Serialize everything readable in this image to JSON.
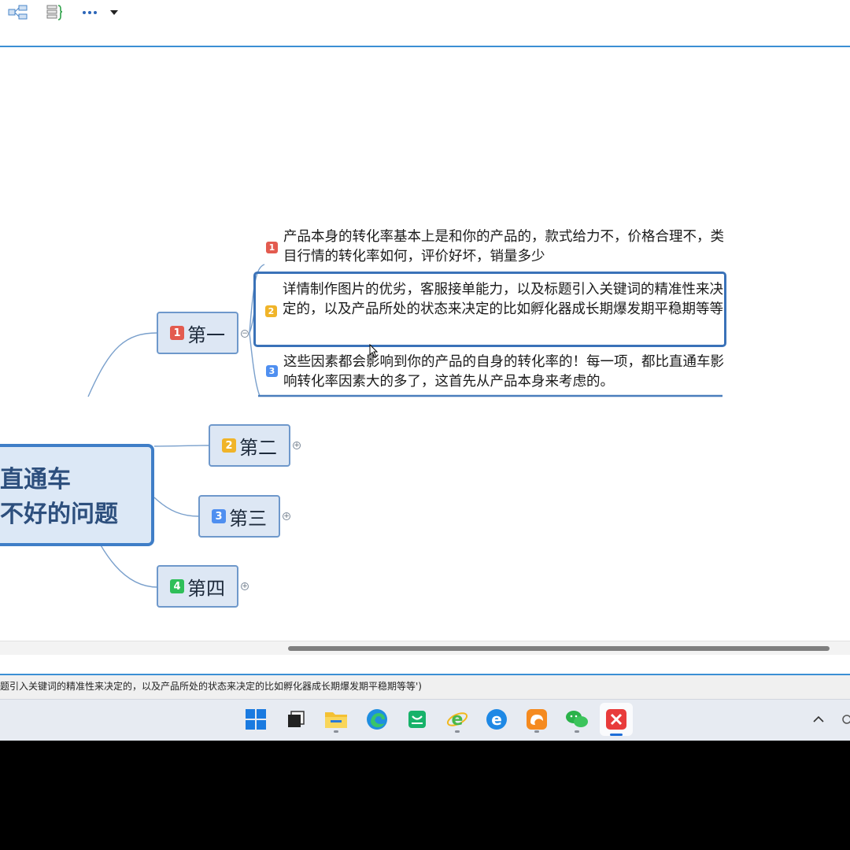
{
  "toolbar": {
    "items": [
      {
        "name": "mindmap-layout-icon"
      },
      {
        "name": "outline-view-icon"
      },
      {
        "name": "more-options-icon"
      },
      {
        "name": "dropdown-arrow-icon"
      }
    ]
  },
  "mindmap": {
    "root": {
      "line1": "直通车",
      "line2": "不好的问题"
    },
    "branches": [
      {
        "badge": "1",
        "label": "第一"
      },
      {
        "badge": "2",
        "label": "第二"
      },
      {
        "badge": "3",
        "label": "第三"
      },
      {
        "badge": "4",
        "label": "第四"
      }
    ],
    "leaves": [
      {
        "badge": "1",
        "text": "产品本身的转化率基本上是和你的产品的，款式给力不，价格合理不，类目行情的转化率如何，评价好坏，销量多少"
      },
      {
        "badge": "2",
        "text": "详情制作图片的优劣，客服接单能力，以及标题引入关键词的精准性来决定的，以及产品所处的状态来决定的比如孵化器成长期爆发期平稳期等等"
      },
      {
        "badge": "3",
        "text": "这些因素都会影响到你的产品的自身的转化率的！每一项，都比直通车影响转化率因素大的多了，这首先从产品本身来考虑的。"
      }
    ]
  },
  "statusbar": {
    "text": "题引入关键词的精准性来决定的，以及产品所处的状态来决定的比如孵化器成长期爆发期平稳期等等')"
  },
  "taskbar": {
    "apps": [
      {
        "name": "start-icon"
      },
      {
        "name": "task-view-icon"
      },
      {
        "name": "file-explorer-icon"
      },
      {
        "name": "edge-browser-icon"
      },
      {
        "name": "store-icon"
      },
      {
        "name": "ie-browser-icon"
      },
      {
        "name": "edge-legacy-icon"
      },
      {
        "name": "uc-browser-icon"
      },
      {
        "name": "wechat-icon"
      },
      {
        "name": "xmind-icon"
      }
    ]
  },
  "colors": {
    "accent": "#3b8fd4",
    "node_fill": "#dde7f4",
    "node_border": "#6e98cb",
    "root_border": "#3f7ec7",
    "badge1": "#e35b4f",
    "badge2": "#f0b429",
    "badge3": "#4f8ff0",
    "badge4": "#2fbf59"
  }
}
